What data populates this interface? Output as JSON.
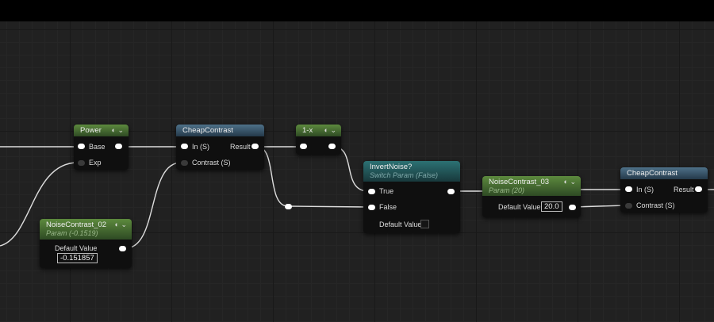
{
  "nodes": {
    "power": {
      "title": "Power",
      "inputs": [
        "Base",
        "Exp"
      ]
    },
    "cheap1": {
      "title": "CheapContrast",
      "inputs": [
        "In (S)",
        "Contrast (S)"
      ],
      "output": "Result"
    },
    "nc02": {
      "title": "NoiseContrast_02",
      "subtitle": "Param (-0.1519)",
      "label": "Default Value",
      "value": "-0.151857"
    },
    "onex": {
      "title": "1-x"
    },
    "invert": {
      "title": "InvertNoise?",
      "subtitle": "Switch Param (False)",
      "inputs": [
        "True",
        "False"
      ],
      "label": "Default Value"
    },
    "nc03": {
      "title": "NoiseContrast_03",
      "subtitle": "Param (20)",
      "label": "Default Value",
      "value": "20.0"
    },
    "cheap2": {
      "title": "CheapContrast",
      "inputs": [
        "In (S)",
        "Contrast (S)"
      ],
      "output": "Result"
    }
  },
  "icons": {
    "preview": "preview-toggle-icon",
    "collapse": "chevron-down-icon"
  }
}
